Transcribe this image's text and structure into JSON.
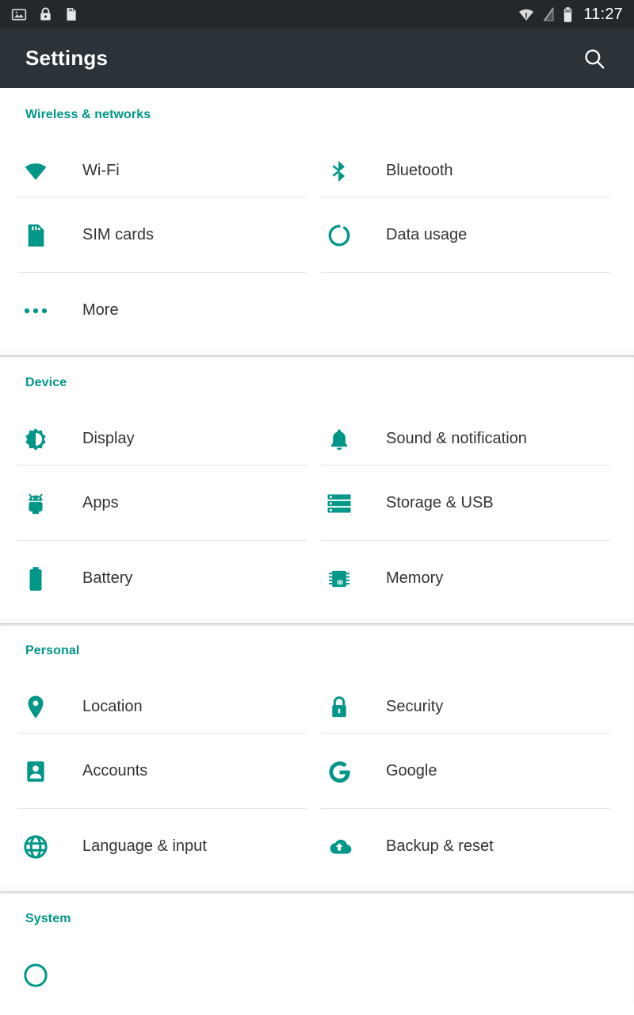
{
  "status_bar": {
    "left_icons": [
      {
        "name": "screenshot-image-icon",
        "label": "Screenshot"
      },
      {
        "name": "screen-lock-icon",
        "label": "Lock"
      },
      {
        "name": "sd-card-icon",
        "label": "SD card"
      }
    ],
    "right_icons": [
      {
        "name": "wifi-no-internet-icon",
        "label": "Wi-Fi no internet"
      },
      {
        "name": "cellular-signal-off-icon",
        "label": "No SIM signal"
      },
      {
        "name": "battery-icon",
        "label": "Battery"
      }
    ],
    "clock": "11:27"
  },
  "app_bar": {
    "title": "Settings",
    "search_label": "Search"
  },
  "colors": {
    "accent": "#009688",
    "app_bar": "#2b3238",
    "status_bar": "#23282c",
    "label_text": "#333333",
    "divider": "#e4e4e4",
    "page_background": "#ffffff"
  },
  "sections": [
    {
      "title": "Wireless & networks",
      "rows": [
        [
          {
            "label": "Wi-Fi",
            "icon": "wifi-icon"
          },
          {
            "label": "Bluetooth",
            "icon": "bluetooth-icon"
          }
        ],
        [
          {
            "label": "SIM cards",
            "icon": "sim-card-icon"
          },
          {
            "label": "Data usage",
            "icon": "data-usage-icon"
          }
        ],
        [
          {
            "label": "More",
            "icon": "more-horizontal-icon"
          },
          {
            "label": "",
            "icon": ""
          }
        ]
      ]
    },
    {
      "title": "Device",
      "rows": [
        [
          {
            "label": "Display",
            "icon": "brightness-icon"
          },
          {
            "label": "Sound & notification",
            "icon": "bell-icon"
          }
        ],
        [
          {
            "label": "Apps",
            "icon": "android-icon"
          },
          {
            "label": "Storage & USB",
            "icon": "storage-icon"
          }
        ],
        [
          {
            "label": "Battery",
            "icon": "battery-full-icon"
          },
          {
            "label": "Memory",
            "icon": "memory-chip-icon"
          }
        ]
      ]
    },
    {
      "title": "Personal",
      "rows": [
        [
          {
            "label": "Location",
            "icon": "location-pin-icon"
          },
          {
            "label": "Security",
            "icon": "lock-icon"
          }
        ],
        [
          {
            "label": "Accounts",
            "icon": "account-card-icon"
          },
          {
            "label": "Google",
            "icon": "google-g-icon"
          }
        ],
        [
          {
            "label": "Language & input",
            "icon": "globe-icon"
          },
          {
            "label": "Backup & reset",
            "icon": "cloud-upload-icon"
          }
        ]
      ]
    },
    {
      "title": "System",
      "rows": []
    }
  ]
}
